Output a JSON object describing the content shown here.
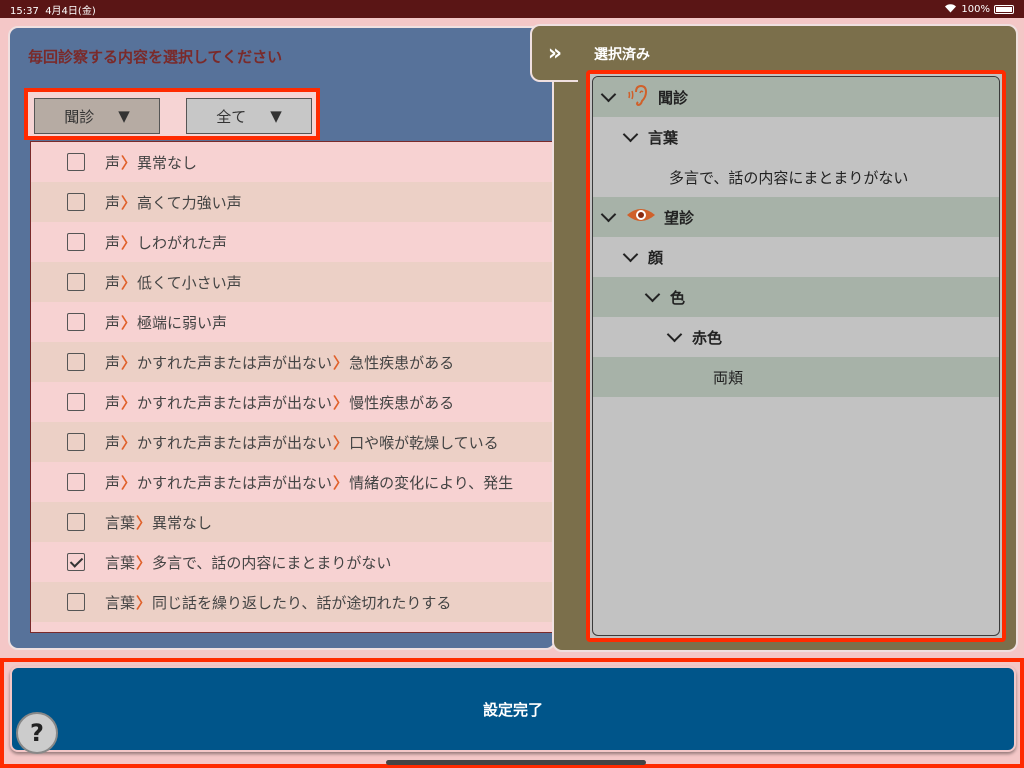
{
  "status": {
    "time": "15:37",
    "date": "4月4日(金)",
    "battery": "100%"
  },
  "left": {
    "title": "毎回診察する内容を選択してください",
    "filter1": "聞診",
    "filter2": "全て",
    "dropdown_glyph": "▼",
    "rows": [
      {
        "checked": false,
        "parts": [
          "声",
          "異常なし"
        ]
      },
      {
        "checked": false,
        "parts": [
          "声",
          "高くて力強い声"
        ]
      },
      {
        "checked": false,
        "parts": [
          "声",
          "しわがれた声"
        ]
      },
      {
        "checked": false,
        "parts": [
          "声",
          "低くて小さい声"
        ]
      },
      {
        "checked": false,
        "parts": [
          "声",
          "極端に弱い声"
        ]
      },
      {
        "checked": false,
        "parts": [
          "声",
          "かすれた声または声が出ない",
          "急性疾患がある"
        ]
      },
      {
        "checked": false,
        "parts": [
          "声",
          "かすれた声または声が出ない",
          "慢性疾患がある"
        ]
      },
      {
        "checked": false,
        "parts": [
          "声",
          "かすれた声または声が出ない",
          "口や喉が乾燥している"
        ]
      },
      {
        "checked": false,
        "parts": [
          "声",
          "かすれた声または声が出ない",
          "情緒の変化により、発生"
        ]
      },
      {
        "checked": false,
        "parts": [
          "言葉",
          "異常なし"
        ]
      },
      {
        "checked": true,
        "parts": [
          "言葉",
          "多言で、話の内容にまとまりがない"
        ]
      },
      {
        "checked": false,
        "parts": [
          "言葉",
          "同じ話を繰り返したり、話が途切れたりする"
        ]
      }
    ]
  },
  "right": {
    "collapse_glyph": "»",
    "title": "選択済み",
    "tree": [
      {
        "label": "聞診",
        "level": 0,
        "icon": "ear-icon",
        "alt": true,
        "caret": true
      },
      {
        "label": "言葉",
        "level": 1,
        "alt": false,
        "caret": true
      },
      {
        "label": "多言で、話の内容にまとまりがない",
        "level": 3,
        "alt": false,
        "caret": false
      },
      {
        "label": "望診",
        "level": 0,
        "icon": "eye-icon",
        "alt": true,
        "caret": true
      },
      {
        "label": "顔",
        "level": 1,
        "alt": false,
        "caret": true
      },
      {
        "label": "色",
        "level": 2,
        "alt": true,
        "caret": true
      },
      {
        "label": "赤色",
        "level": 3,
        "alt": false,
        "caret": true
      },
      {
        "label": "両頬",
        "level": 5,
        "alt": true,
        "caret": false
      }
    ]
  },
  "bottom": {
    "done_label": "設定完了",
    "help_label": "?"
  },
  "colors": {
    "accent": "#ff2a00",
    "button": "#00558a",
    "chevron": "#e0602a"
  }
}
